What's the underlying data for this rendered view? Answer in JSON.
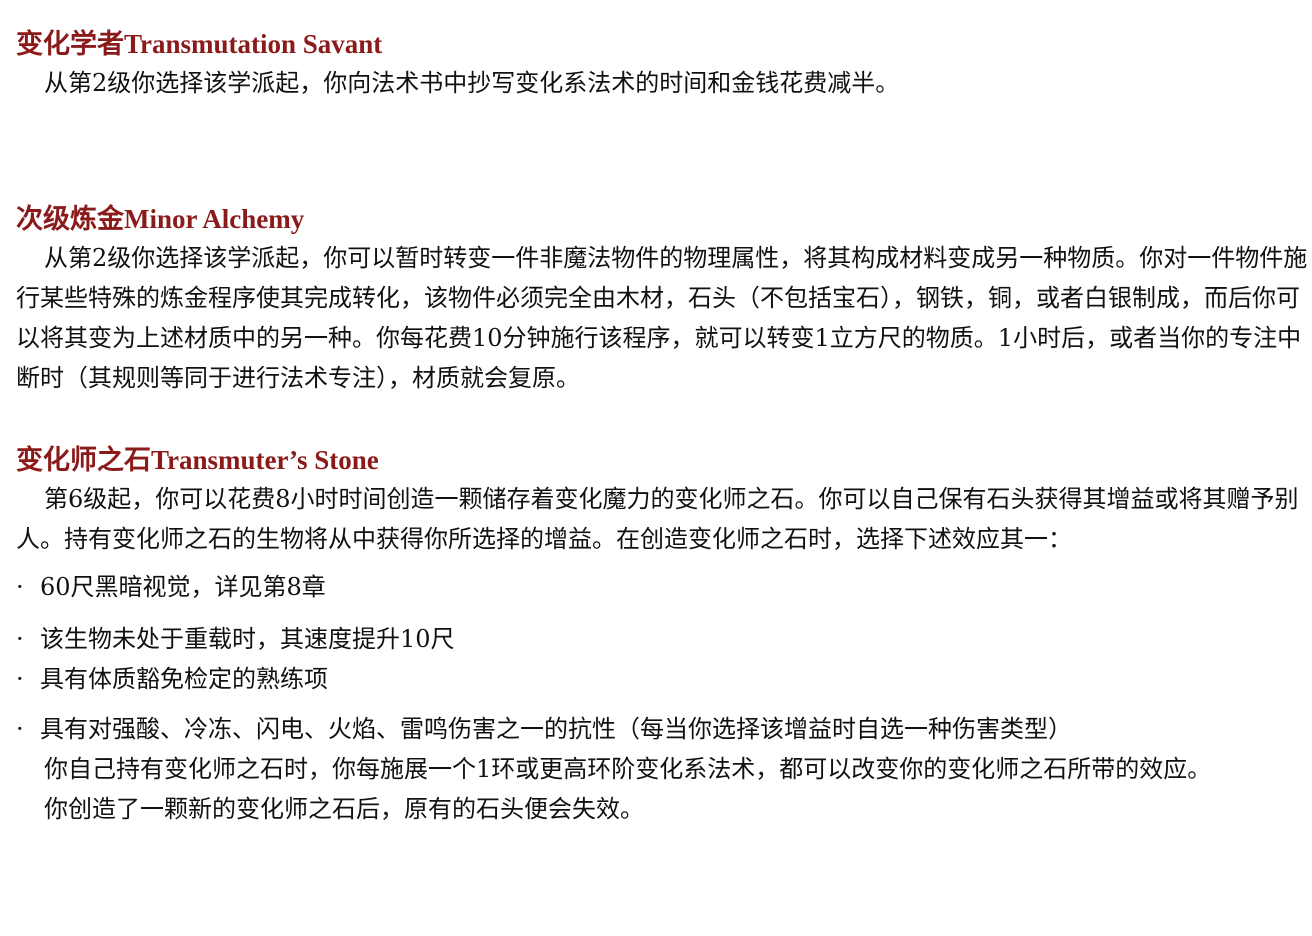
{
  "sections": [
    {
      "heading_zh": "变化学者",
      "heading_en": "Transmutation Savant",
      "paragraphs": [
        "从第2级你选择该学派起，你向法术书中抄写变化系法术的时间和金钱花费减半。"
      ]
    },
    {
      "heading_zh": "次级炼金",
      "heading_en": "Minor Alchemy",
      "paragraphs": [
        "从第2级你选择该学派起，你可以暂时转变一件非魔法物件的物理属性，将其构成材料变成另一种物质。你对一件物件施行某些特殊的炼金程序使其完成转化，该物件必须完全由木材，石头（不包括宝石），钢铁，铜，或者白银制成，而后你可以将其变为上述材质中的另一种。你每花费10分钟施行该程序，就可以转变1立方尺的物质。1小时后，或者当你的专注中断时（其规则等同于进行法术专注），材质就会复原。"
      ]
    },
    {
      "heading_zh": "变化师之石",
      "heading_en": "Transmuter’s Stone",
      "intro": "第6级起，你可以花费8小时时间创造一颗储存着变化魔力的变化师之石。你可以自己保有石头获得其增益或将其赠予别人。持有变化师之石的生物将从中获得你所选择的增益。在创造变化师之石时，选择下述效应其一：",
      "bullet_marker": "·",
      "bullets": [
        "60尺黑暗视觉，详见第8章",
        "该生物未处于重载时，其速度提升10尺",
        "具有体质豁免检定的熟练项",
        "具有对强酸、冷冻、闪电、火焰、雷鸣伤害之一的抗性（每当你选择该增益时自选一种伤害类型）"
      ],
      "outro": [
        "你自己持有变化师之石时，你每施展一个1环或更高环阶变化系法术，都可以改变你的变化师之石所带的效应。",
        "你创造了一颗新的变化师之石后，原有的石头便会失效。"
      ]
    }
  ],
  "colors": {
    "heading": "#8b1a1a",
    "text": "#111111",
    "background": "#ffffff"
  }
}
